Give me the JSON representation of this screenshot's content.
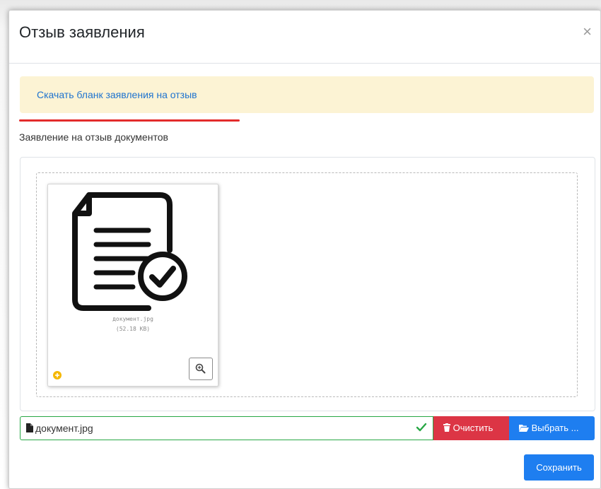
{
  "modal": {
    "title": "Отзыв заявления",
    "close_label": "×"
  },
  "alert": {
    "link_text": "Скачать бланк заявления на отзыв"
  },
  "upload": {
    "label": "Заявление на отзыв документов",
    "preview": {
      "file_name": "документ.jpg",
      "file_size": "(52.18 KB)",
      "icon": "document-check-icon"
    },
    "caption": {
      "file_name": "документ.jpg",
      "status_icon": "check-icon"
    },
    "clear_label": "Очистить",
    "choose_label": "Выбрать ..."
  },
  "footer": {
    "save_label": "Сохранить"
  },
  "colors": {
    "alert_bg": "#fcf3d4",
    "link": "#1e73cf",
    "danger": "#dc3545",
    "primary": "#1e7ef0",
    "success": "#28a745",
    "highlight_underline": "#e32b2b"
  }
}
